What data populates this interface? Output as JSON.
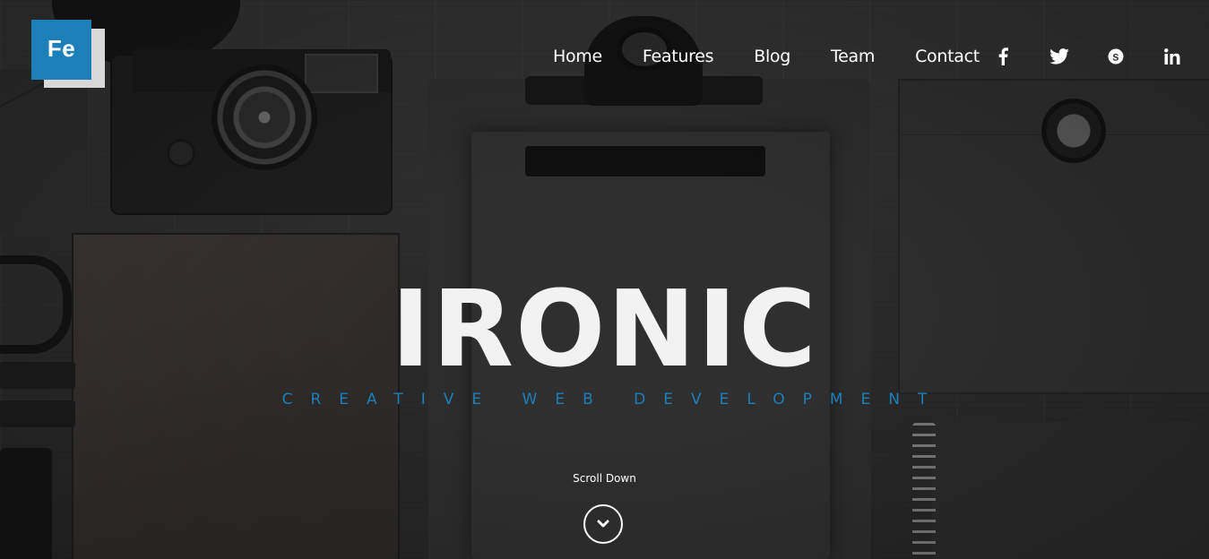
{
  "logo": {
    "text": "Fe"
  },
  "nav": {
    "items": [
      {
        "label": "Home"
      },
      {
        "label": "Features"
      },
      {
        "label": "Blog"
      },
      {
        "label": "Team"
      },
      {
        "label": "Contact"
      }
    ]
  },
  "social": [
    {
      "icon": "facebook-icon"
    },
    {
      "icon": "twitter-icon"
    },
    {
      "icon": "skype-icon"
    },
    {
      "icon": "linkedin-icon"
    }
  ],
  "hero": {
    "title": "IRONIC",
    "subtitle": "CREATIVE WEB DEVELOPMENT",
    "scroll_label": "Scroll Down"
  },
  "colors": {
    "accent": "#1d7fb8",
    "text": "#ffffff"
  }
}
